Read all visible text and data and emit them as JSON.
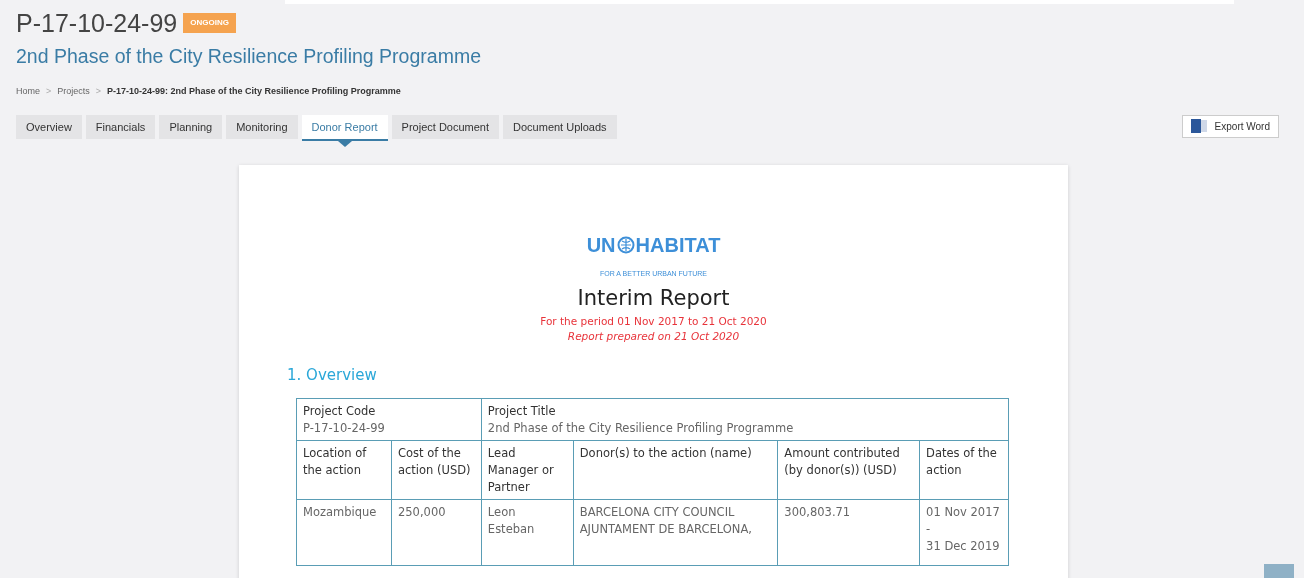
{
  "project": {
    "code": "P-17-10-24-99",
    "status": "ONGOING",
    "title": "2nd Phase of the City Resilience Profiling Programme"
  },
  "breadcrumb": [
    {
      "label": "Home",
      "current": false
    },
    {
      "label": "Projects",
      "current": false
    },
    {
      "label": "P-17-10-24-99: 2nd Phase of the City Resilience Profiling Programme",
      "current": true
    }
  ],
  "breadcrumb_separator": ">",
  "tabs": [
    {
      "label": "Overview",
      "selected": false
    },
    {
      "label": "Financials",
      "selected": false
    },
    {
      "label": "Planning",
      "selected": false
    },
    {
      "label": "Monitoring",
      "selected": false
    },
    {
      "label": "Donor Report",
      "selected": true
    },
    {
      "label": "Project Document",
      "selected": false
    },
    {
      "label": "Document Uploads",
      "selected": false
    }
  ],
  "export_button": {
    "label": "Export Word"
  },
  "report": {
    "logo": {
      "left": "UN",
      "right": "HABITAT",
      "tagline": "FOR A BETTER URBAN FUTURE"
    },
    "title": "Interim Report",
    "period": "For the period 01 Nov 2017 to 21 Oct 2020",
    "prepared": "Report prepared on 21 Oct 2020",
    "section": "1. Overview",
    "summary": [
      {
        "label": "Project Code",
        "value": "P-17-10-24-99"
      },
      {
        "label": "Project Title",
        "value": "2nd Phase of the City Resilience Profiling Programme"
      }
    ],
    "columns": [
      "Location of the action",
      "Cost of the action (USD)",
      "Lead Manager or Partner",
      "Donor(s) to the action (name)",
      "Amount contributed (by donor(s)) (USD)",
      "Dates of the action"
    ],
    "rows": [
      {
        "cells": [
          [
            "Mozambique"
          ],
          [
            "250,000"
          ],
          [
            "Leon",
            "Esteban"
          ],
          [
            "BARCELONA CITY COUNCIL",
            "AJUNTAMENT DE BARCELONA,"
          ],
          [
            "300,803.71"
          ],
          [
            "01 Nov 2017",
            "-",
            "31 Dec 2019"
          ]
        ]
      }
    ]
  }
}
